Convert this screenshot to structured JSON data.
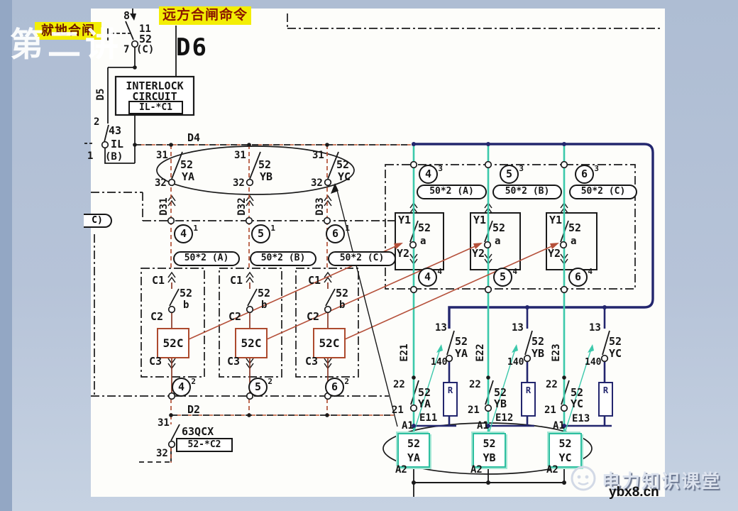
{
  "colors": {
    "background": "#b6c3d8",
    "panel": "#fdfdfa",
    "line": "#1a1a1a",
    "accent_red": "#b14a2e",
    "navy": "#23266e",
    "teal": "#3cc9ab",
    "highlight_yellow": "#f3ee04"
  },
  "overlays": {
    "watermark_title": "第二讲",
    "local_close": "就地合闸",
    "remote_close": "远方合闸命令",
    "brand_name": "电力知识课堂",
    "brand_site": "ybx8.cn"
  },
  "top": {
    "sheet": "D6",
    "bus": "D4",
    "pb": {
      "top": "8",
      "n11": "11",
      "n52": "52",
      "ph": "(C)",
      "bottom": "7"
    },
    "interlock": {
      "l1": "INTERLOCK",
      "l2": "CIRCUIT",
      "tag": "IL-*C1",
      "wire": "D5"
    },
    "sw43": {
      "top": "2",
      "name": "43",
      "name2": "IL",
      "pos": "(B)",
      "bottom": "1"
    }
  },
  "left": {
    "edge_tag": "C)",
    "bus2": "D2",
    "relays": [
      "50*2 (A)",
      "50*2 (B)",
      "50*2 (C)"
    ],
    "phase_row": [
      {
        "top": "31",
        "dev": "52",
        "ph": "YA",
        "bot": "32",
        "wire": "D31",
        "node_num": "4",
        "node_sup": "1"
      },
      {
        "top": "31",
        "dev": "52",
        "ph": "YB",
        "bot": "32",
        "wire": "D32",
        "node_num": "5",
        "node_sup": "1"
      },
      {
        "top": "31",
        "dev": "52",
        "ph": "YC",
        "bot": "32",
        "wire": "D33",
        "node_num": "6",
        "node_sup": "1"
      }
    ],
    "columns": [
      {
        "t1": "C1",
        "dev": "52",
        "pos": "b",
        "t2": "C2",
        "coil": "52C",
        "t3": "C3",
        "node_num": "4",
        "node_sup": "2"
      },
      {
        "t1": "C1",
        "dev": "52",
        "pos": "b",
        "t2": "C2",
        "coil": "52C",
        "t3": "C3",
        "node_num": "5",
        "node_sup": "2"
      },
      {
        "t1": "C1",
        "dev": "52",
        "pos": "b",
        "t2": "C2",
        "coil": "52C",
        "t3": "C3",
        "node_num": "6",
        "node_sup": "2"
      }
    ],
    "cutout": {
      "top": "31",
      "name": "63QCX",
      "tag": "52-*C2",
      "bot": "32"
    }
  },
  "right": {
    "bays": [
      {
        "node3_num": "4",
        "node3_sup": "3",
        "relay": "50*2 (A)",
        "y1": "Y1",
        "dev": "52",
        "pos": "a",
        "y2": "Y2",
        "node4_num": "4",
        "node4_sup": "4",
        "a13": "13",
        "adev": "52",
        "aph": "YA",
        "a140": "140",
        "wire": "E21",
        "b22": "22",
        "bdev": "52",
        "bph": "YA",
        "b21": "21",
        "btag": "E11",
        "res": "R",
        "c_a1": "A1",
        "cdev": "52",
        "cph": "YA",
        "c_a2": "A2"
      },
      {
        "node3_num": "5",
        "node3_sup": "3",
        "relay": "50*2 (B)",
        "y1": "Y1",
        "dev": "52",
        "pos": "a",
        "y2": "Y2",
        "node4_num": "5",
        "node4_sup": "4",
        "a13": "13",
        "adev": "52",
        "aph": "YB",
        "a140": "140",
        "wire": "E22",
        "b22": "22",
        "bdev": "52",
        "bph": "YB",
        "b21": "21",
        "btag": "E12",
        "res": "R",
        "c_a1": "A1",
        "cdev": "52",
        "cph": "YB",
        "c_a2": "A2"
      },
      {
        "node3_num": "6",
        "node3_sup": "3",
        "relay": "50*2 (C)",
        "y1": "Y1",
        "dev": "52",
        "pos": "a",
        "y2": "Y2",
        "node4_num": "6",
        "node4_sup": "4",
        "a13": "13",
        "adev": "52",
        "aph": "YC",
        "a140": "140",
        "wire": "E23",
        "b22": "22",
        "bdev": "52",
        "bph": "YC",
        "b21": "21",
        "btag": "E13",
        "res": "R",
        "c_a1": "A1",
        "cdev": "52",
        "cph": "YC",
        "c_a2": "A2"
      }
    ]
  }
}
